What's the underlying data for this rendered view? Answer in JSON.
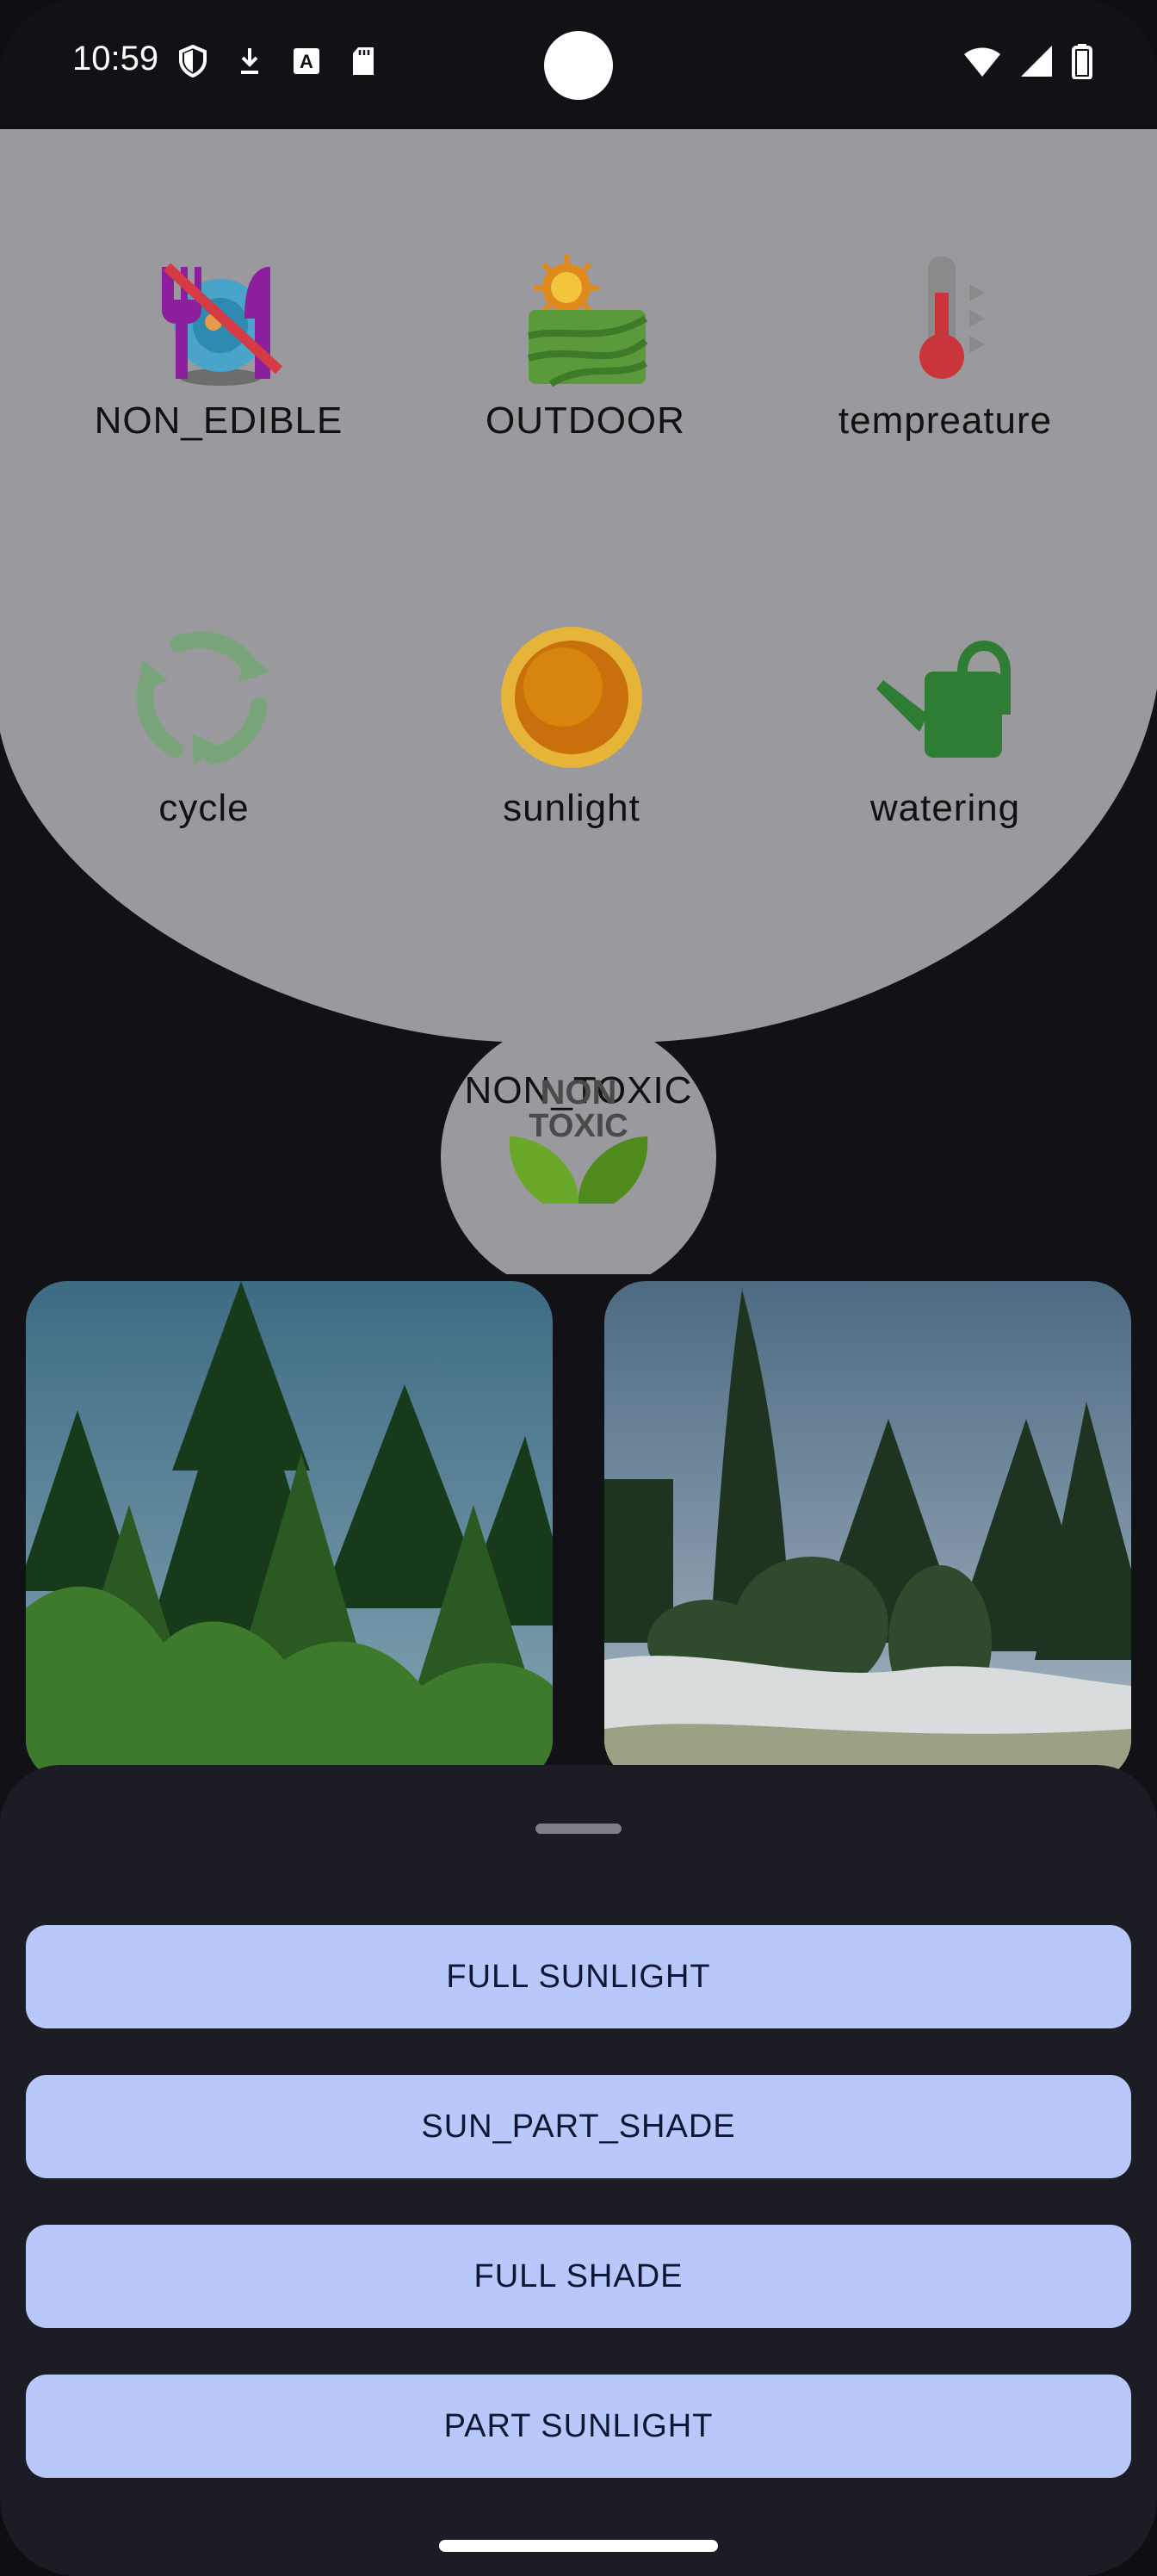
{
  "status_bar": {
    "time": "10:59",
    "left_icons": [
      "shield-icon",
      "download-icon",
      "keyboard-a-icon",
      "sd-card-icon"
    ],
    "right_icons": [
      "wifi-icon",
      "cell-signal-icon",
      "battery-icon"
    ]
  },
  "features": [
    {
      "label": "NON_EDIBLE",
      "icon": "non-edible-icon"
    },
    {
      "label": "OUTDOOR",
      "icon": "outdoor-field-icon"
    },
    {
      "label": "tempreature",
      "icon": "thermometer-icon"
    },
    {
      "label": "cycle",
      "icon": "cycle-icon"
    },
    {
      "label": "sunlight",
      "icon": "sun-icon"
    },
    {
      "label": "watering",
      "icon": "watering-can-icon"
    }
  ],
  "toxicity": {
    "label": "NON_TOXIC",
    "badge_text_1": "NON",
    "badge_text_2": "TOXIC",
    "icon": "non-toxic-leaf-icon"
  },
  "photos": [
    {
      "name": "evergreen-trees-photo"
    },
    {
      "name": "weeping-conifer-garden-photo"
    }
  ],
  "sheet": {
    "options": [
      "FULL SUNLIGHT",
      "SUN_PART_SHADE",
      "FULL SHADE",
      "PART SUNLIGHT"
    ]
  },
  "colors": {
    "bubble": "#9a999e",
    "sheet": "#1b1c24",
    "option_button": "#b8c8fb",
    "option_text": "#0f1633"
  }
}
